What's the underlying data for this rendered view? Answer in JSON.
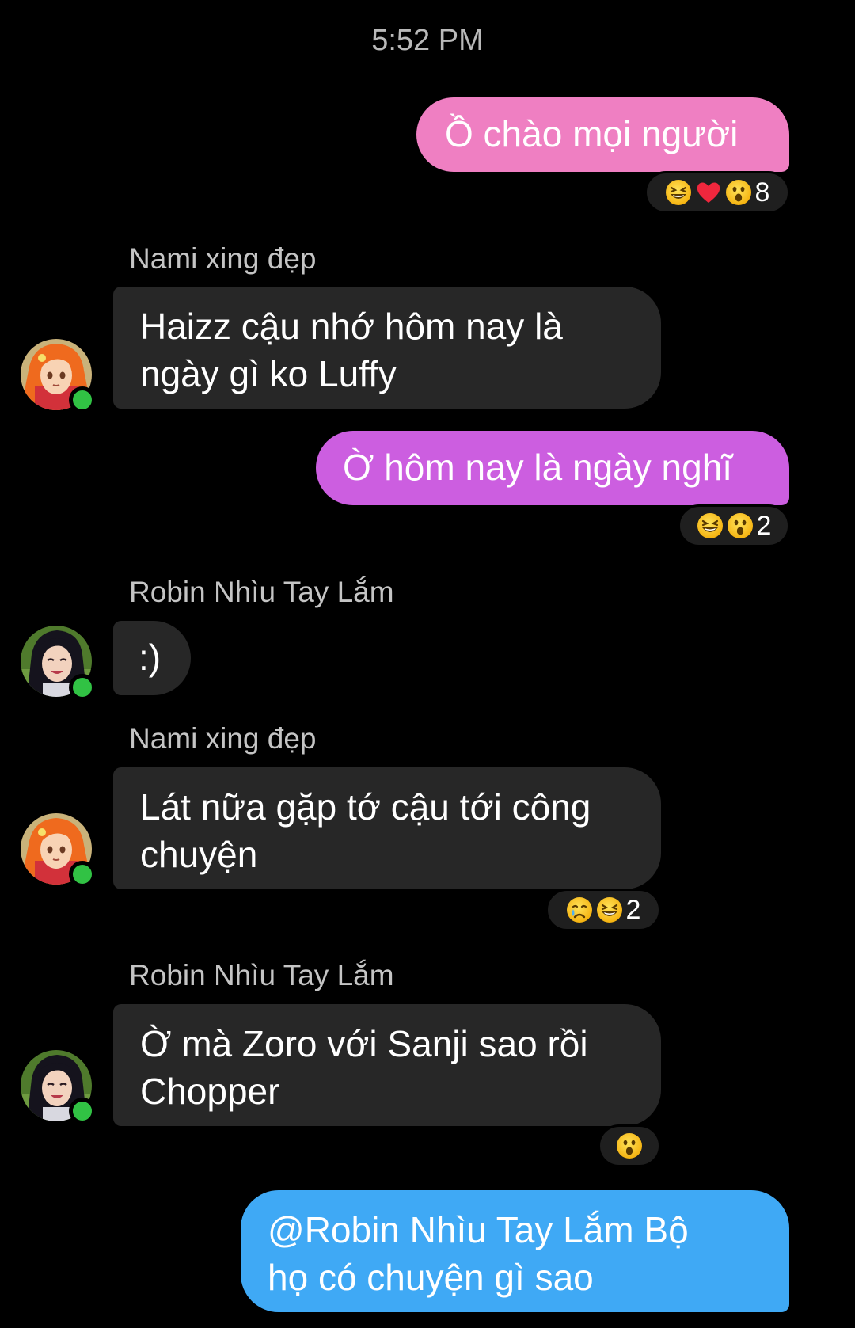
{
  "timestamp": "5:52 PM",
  "messages": [
    {
      "type": "sent",
      "text": "Ồ chào mọi người",
      "reactions": [
        "laugh",
        "heart",
        "wow"
      ],
      "count": "8"
    },
    {
      "type": "received",
      "sender": "Nami xing đẹp",
      "text_lines": [
        "Haizz cậu nhớ hôm nay là",
        "ngày gì ko Luffy"
      ]
    },
    {
      "type": "sent",
      "text": "Ờ hôm nay là ngày nghĩ",
      "reactions": [
        "laugh",
        "wow"
      ],
      "count": "2"
    },
    {
      "type": "received",
      "sender": "Robin Nhìu Tay Lắm",
      "text_lines": [
        ":)"
      ]
    },
    {
      "type": "received",
      "sender": "Nami xing đẹp",
      "text_lines": [
        "Lát nữa gặp tớ cậu tới công",
        "chuyện"
      ],
      "reactions": [
        "sad",
        "laugh"
      ],
      "count": "2"
    },
    {
      "type": "received",
      "sender": "Robin Nhìu Tay Lắm",
      "text_lines": [
        "Ờ mà Zoro với Sanji sao rồi",
        "Chopper"
      ],
      "reactions": [
        "wow"
      ]
    },
    {
      "type": "sent",
      "text_lines": [
        "@Robin Nhìu Tay Lắm Bộ",
        "họ có chuyện gì sao"
      ]
    }
  ],
  "colors": {
    "bubble_1": "#ef7fc2",
    "bubble_2": "#cc5ee0",
    "bubble_3": "#3fa9f5",
    "received_bubble": "#272727",
    "online": "#31c244",
    "background": "#000000"
  }
}
